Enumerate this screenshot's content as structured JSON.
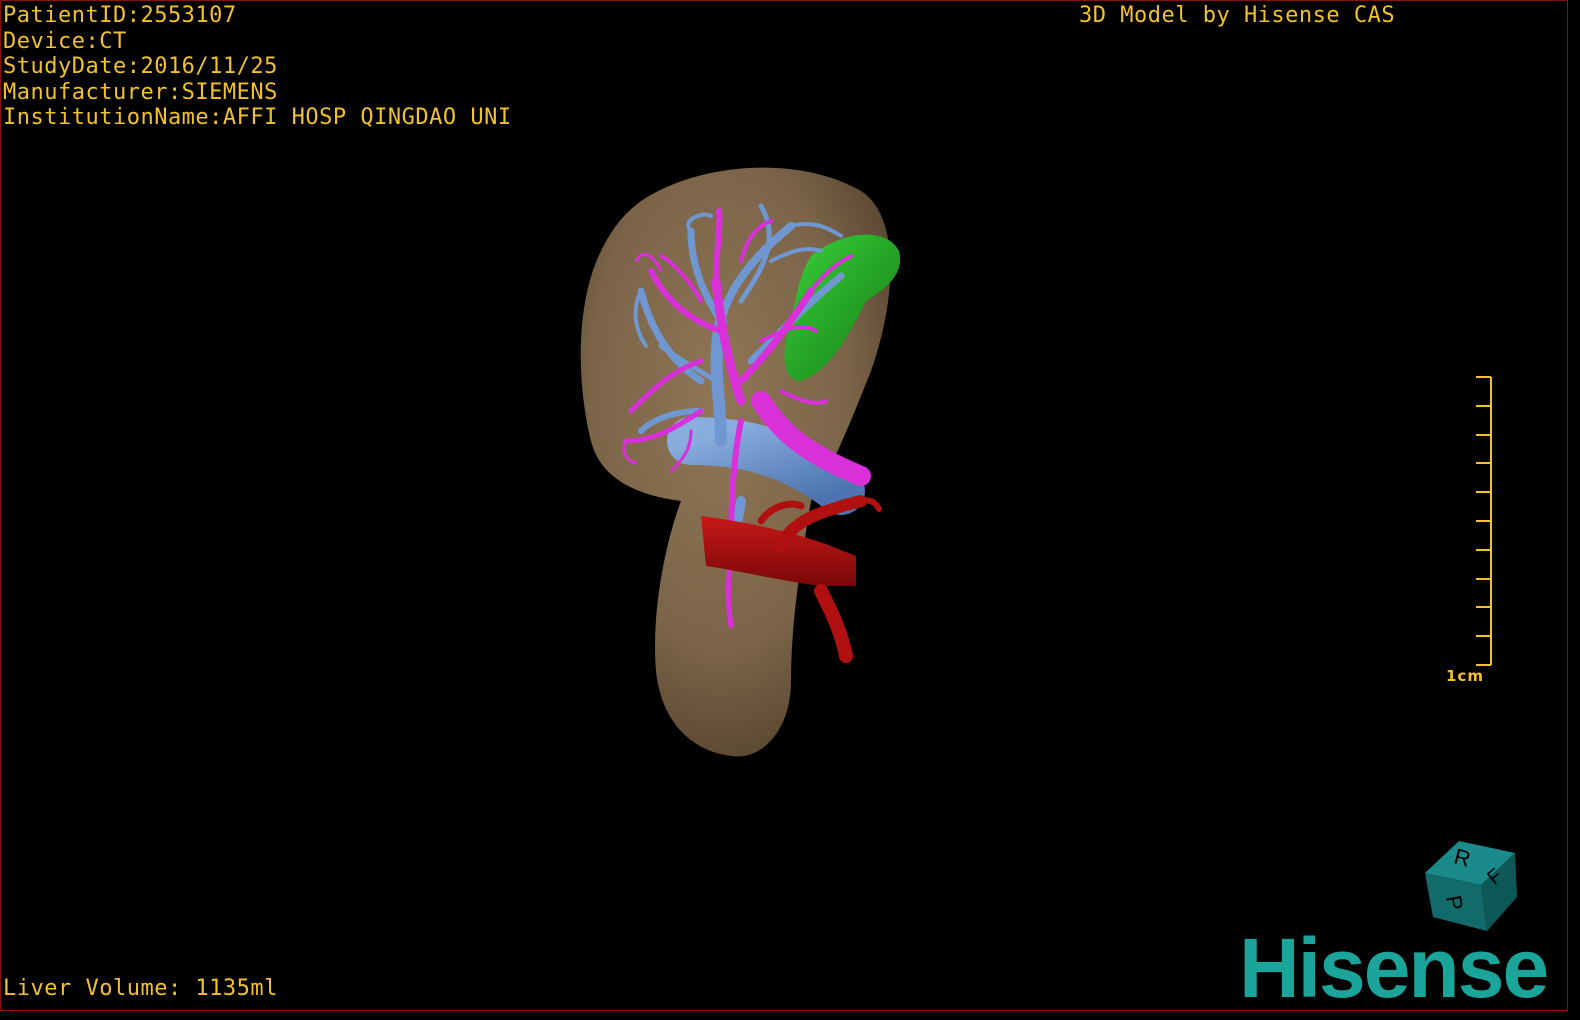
{
  "header": {
    "patient_id": "PatientID:2553107",
    "device": "Device:CT",
    "study_date": "StudyDate:2016/11/25",
    "manufacturer": "Manufacturer:SIEMENS",
    "institution": "InstitutionName:AFFI HOSP QINGDAO UNI"
  },
  "credit": "3D Model by Hisense CAS",
  "footer": {
    "liver_volume": "Liver Volume: 1135ml"
  },
  "scale_bar": {
    "label": "1cm",
    "ticks": 10
  },
  "orientation_cube": {
    "faces": [
      "R",
      "F",
      "P"
    ]
  },
  "brand": "Hisense",
  "colors": {
    "text": "#f2c12e",
    "liver": "#7b6448",
    "portal_vein": "#6f97d2",
    "hepatic_vein": "#d930d9",
    "artery": "#b01010",
    "gallbladder": "#1fa01f",
    "brand": "#1ba49a",
    "border": "#8a1010"
  }
}
